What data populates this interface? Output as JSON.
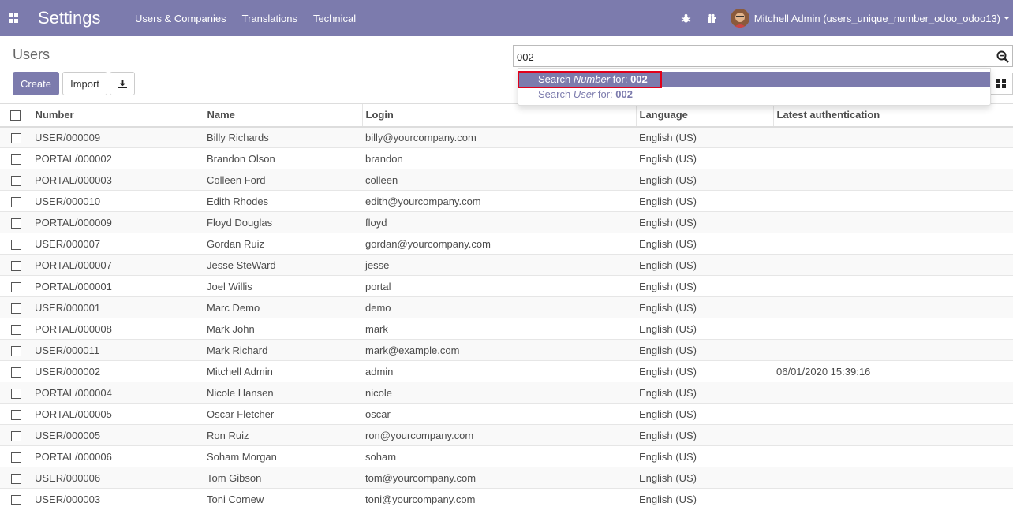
{
  "navbar": {
    "brand": "Settings",
    "menu": [
      "Users & Companies",
      "Translations",
      "Technical"
    ],
    "user_name": "Mitchell Admin (users_unique_number_odoo_odoo13)",
    "accent_color": "#7c7bad"
  },
  "control_panel": {
    "title": "Users",
    "create_label": "Create",
    "import_label": "Import",
    "search_value": "002"
  },
  "search_dropdown": {
    "items": [
      {
        "prefix": "Search ",
        "field": "Number",
        "mid": " for: ",
        "term": "002"
      },
      {
        "prefix": "Search ",
        "field": "User",
        "mid": " for: ",
        "term": "002"
      }
    ]
  },
  "table": {
    "headers": [
      "Number",
      "Name",
      "Login",
      "Language",
      "Latest authentication"
    ],
    "rows": [
      [
        "USER/000009",
        "Billy Richards",
        "billy@yourcompany.com",
        "English (US)",
        ""
      ],
      [
        "PORTAL/000002",
        "Brandon Olson",
        "brandon",
        "English (US)",
        ""
      ],
      [
        "PORTAL/000003",
        "Colleen Ford",
        "colleen",
        "English (US)",
        ""
      ],
      [
        "USER/000010",
        "Edith Rhodes",
        "edith@yourcompany.com",
        "English (US)",
        ""
      ],
      [
        "PORTAL/000009",
        "Floyd Douglas",
        "floyd",
        "English (US)",
        ""
      ],
      [
        "USER/000007",
        "Gordan Ruiz",
        "gordan@yourcompany.com",
        "English (US)",
        ""
      ],
      [
        "PORTAL/000007",
        "Jesse SteWard",
        "jesse",
        "English (US)",
        ""
      ],
      [
        "PORTAL/000001",
        "Joel Willis",
        "portal",
        "English (US)",
        ""
      ],
      [
        "USER/000001",
        "Marc Demo",
        "demo",
        "English (US)",
        ""
      ],
      [
        "PORTAL/000008",
        "Mark John",
        "mark",
        "English (US)",
        ""
      ],
      [
        "USER/000011",
        "Mark Richard",
        "mark@example.com",
        "English (US)",
        ""
      ],
      [
        "USER/000002",
        "Mitchell Admin",
        "admin",
        "English (US)",
        "06/01/2020 15:39:16"
      ],
      [
        "PORTAL/000004",
        "Nicole Hansen",
        "nicole",
        "English (US)",
        ""
      ],
      [
        "PORTAL/000005",
        "Oscar Fletcher",
        "oscar",
        "English (US)",
        ""
      ],
      [
        "USER/000005",
        "Ron Ruiz",
        "ron@yourcompany.com",
        "English (US)",
        ""
      ],
      [
        "PORTAL/000006",
        "Soham Morgan",
        "soham",
        "English (US)",
        ""
      ],
      [
        "USER/000006",
        "Tom Gibson",
        "tom@yourcompany.com",
        "English (US)",
        ""
      ],
      [
        "USER/000003",
        "Toni Cornew",
        "toni@yourcompany.com",
        "English (US)",
        ""
      ]
    ]
  }
}
